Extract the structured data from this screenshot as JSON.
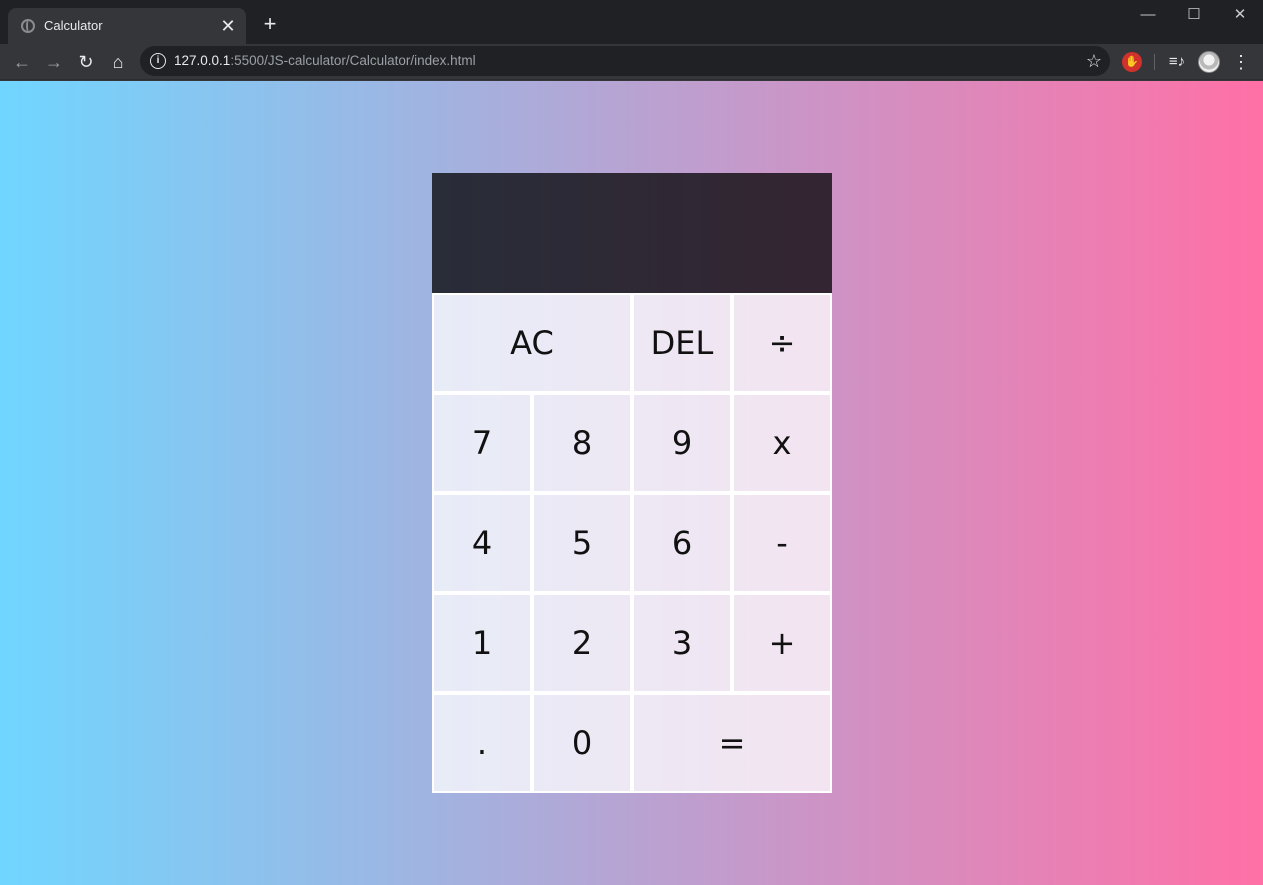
{
  "browser": {
    "tab_title": "Calculator",
    "tab_close": "✕",
    "new_tab": "+",
    "window_controls": {
      "minimize": "—",
      "maximize": "☐",
      "close": "✕"
    },
    "url_host": "127.0.0.1",
    "url_rest": ":5500/JS-calculator/Calculator/index.html",
    "icons": {
      "back": "←",
      "forward": "→",
      "reload": "↻",
      "home": "⌂",
      "info": "i",
      "star": "☆",
      "extension": "✋",
      "media": "≡♪",
      "menu": "⋮"
    }
  },
  "calculator": {
    "previous_operand": "",
    "current_operand": "",
    "keys": {
      "ac": "AC",
      "del": "DEL",
      "divide": "÷",
      "seven": "7",
      "eight": "8",
      "nine": "9",
      "multiply": "x",
      "four": "4",
      "five": "5",
      "six": "6",
      "subtract": "-",
      "one": "1",
      "two": "2",
      "three": "3",
      "add": "+",
      "decimal": ".",
      "zero": "0",
      "equals": "="
    }
  },
  "colors": {
    "gradient_start": "#70d6ff",
    "gradient_end": "#ff70a6",
    "display_background": "rgba(0,0,0,0.75)",
    "key_background": "rgba(255,255,255,0.75)"
  }
}
